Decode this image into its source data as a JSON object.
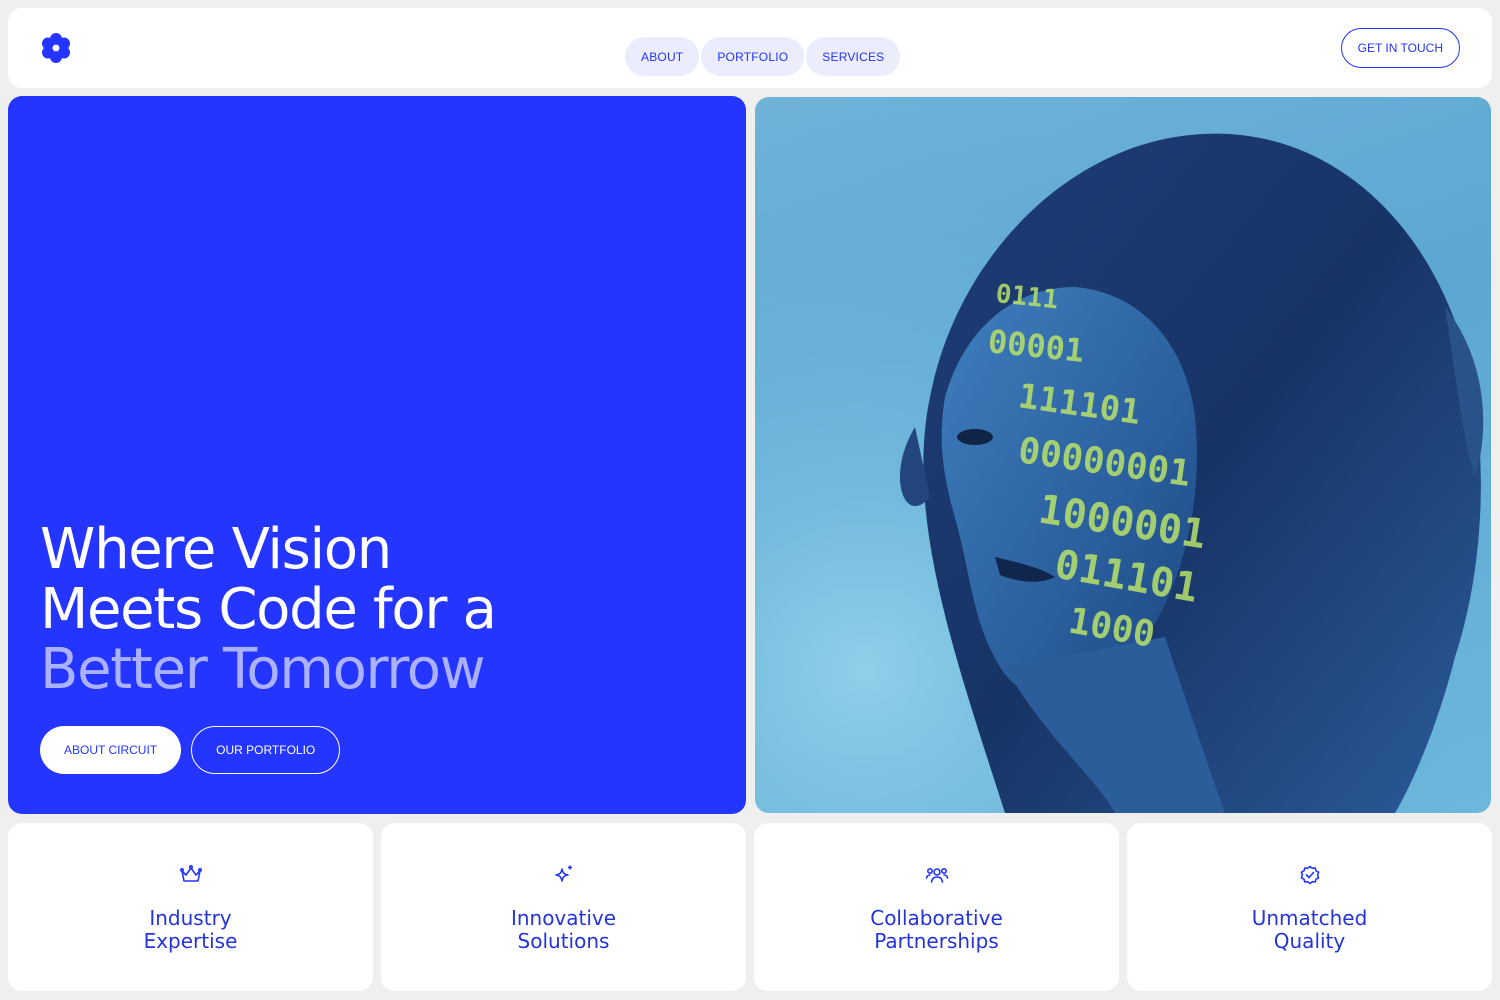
{
  "colors": {
    "brand": "#2335ff",
    "accent_text": "#aab1ff",
    "pill_bg": "#ebedfc",
    "page_bg": "#efefef"
  },
  "header": {
    "logo_icon": "flower-logo-icon",
    "nav": [
      {
        "label": "ABOUT"
      },
      {
        "label": "PORTFOLIO"
      },
      {
        "label": "SERVICES"
      }
    ],
    "cta_label": "GET IN TOUCH"
  },
  "hero": {
    "title_line1": "Where Vision",
    "title_line2": "Meets Code for a",
    "title_line3": "Better Tomorrow",
    "primary_button": "ABOUT CIRCUIT",
    "secondary_button": "OUR PORTFOLIO"
  },
  "features": [
    {
      "icon": "crown-icon",
      "label": "Industry\nExpertise"
    },
    {
      "icon": "sparkle-icon",
      "label": "Innovative\nSolutions"
    },
    {
      "icon": "people-icon",
      "label": "Collaborative\nPartnerships"
    },
    {
      "icon": "badge-check-icon",
      "label": "Unmatched\nQuality"
    }
  ]
}
